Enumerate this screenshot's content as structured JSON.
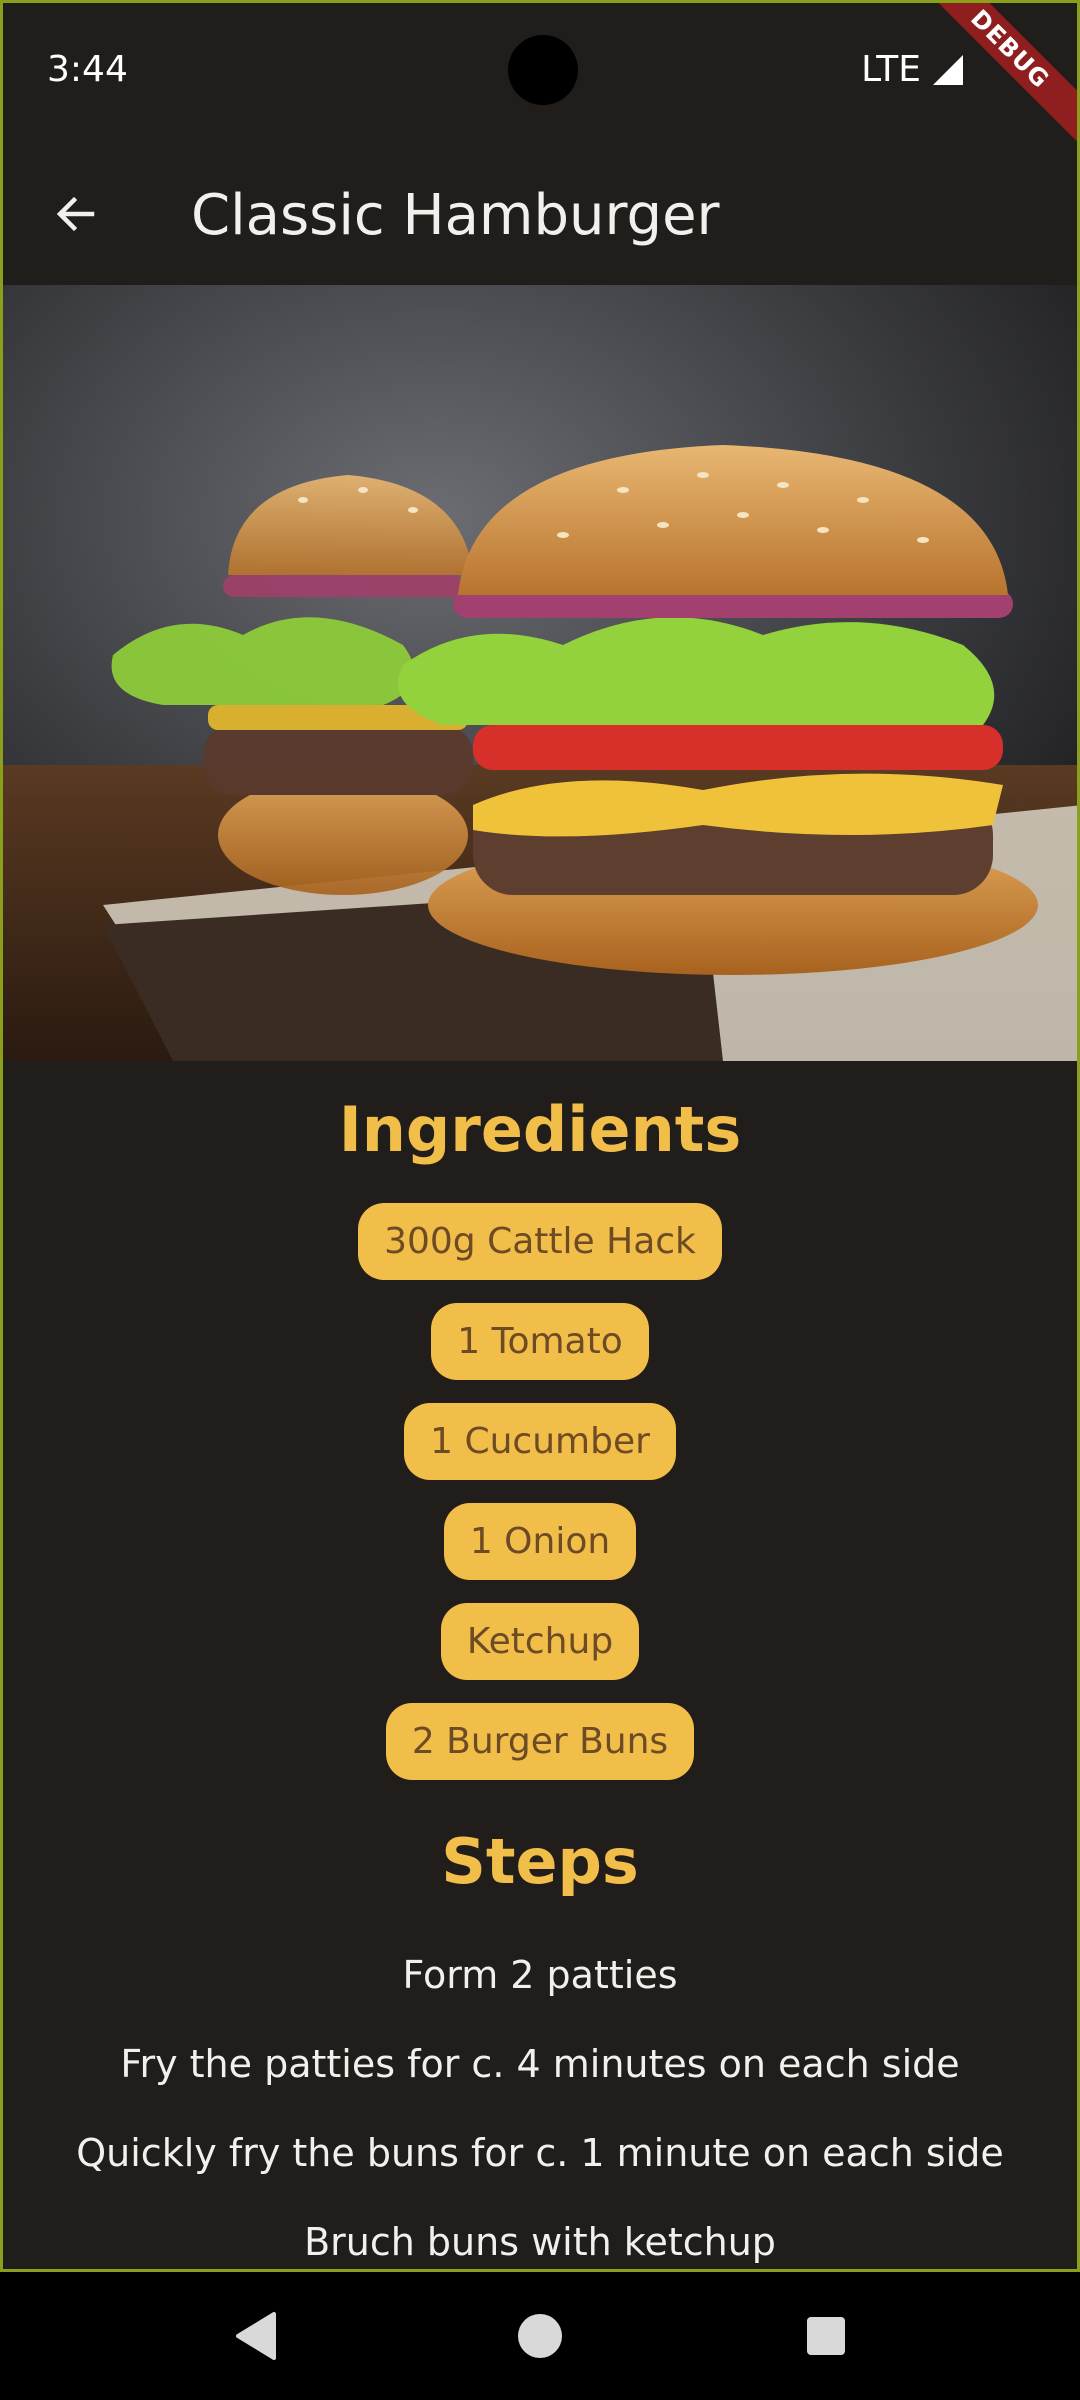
{
  "status": {
    "time": "3:44",
    "network": "LTE",
    "debug_label": "DEBUG"
  },
  "app_bar": {
    "title": "Classic Hamburger",
    "back_icon": "arrow-back-icon"
  },
  "hero_image": {
    "description_icon": "hamburger-photo"
  },
  "ingredients": {
    "title": "Ingredients",
    "items": [
      "300g Cattle Hack",
      "1 Tomato",
      "1 Cucumber",
      "1 Onion",
      "Ketchup",
      "2 Burger Buns"
    ]
  },
  "steps": {
    "title": "Steps",
    "items": [
      "Form 2 patties",
      "Fry the patties for c. 4 minutes on each side",
      "Quickly fry the buns for c. 1 minute on each side",
      "Bruch buns with ketchup"
    ]
  },
  "nav": {
    "back_icon": "nav-back-icon",
    "home_icon": "nav-home-icon",
    "recents_icon": "nav-recents-icon"
  },
  "colors": {
    "background": "#201d1a",
    "accent": "#f2be4a",
    "chip_text": "#6d4b25",
    "text": "#f2f0ec"
  }
}
